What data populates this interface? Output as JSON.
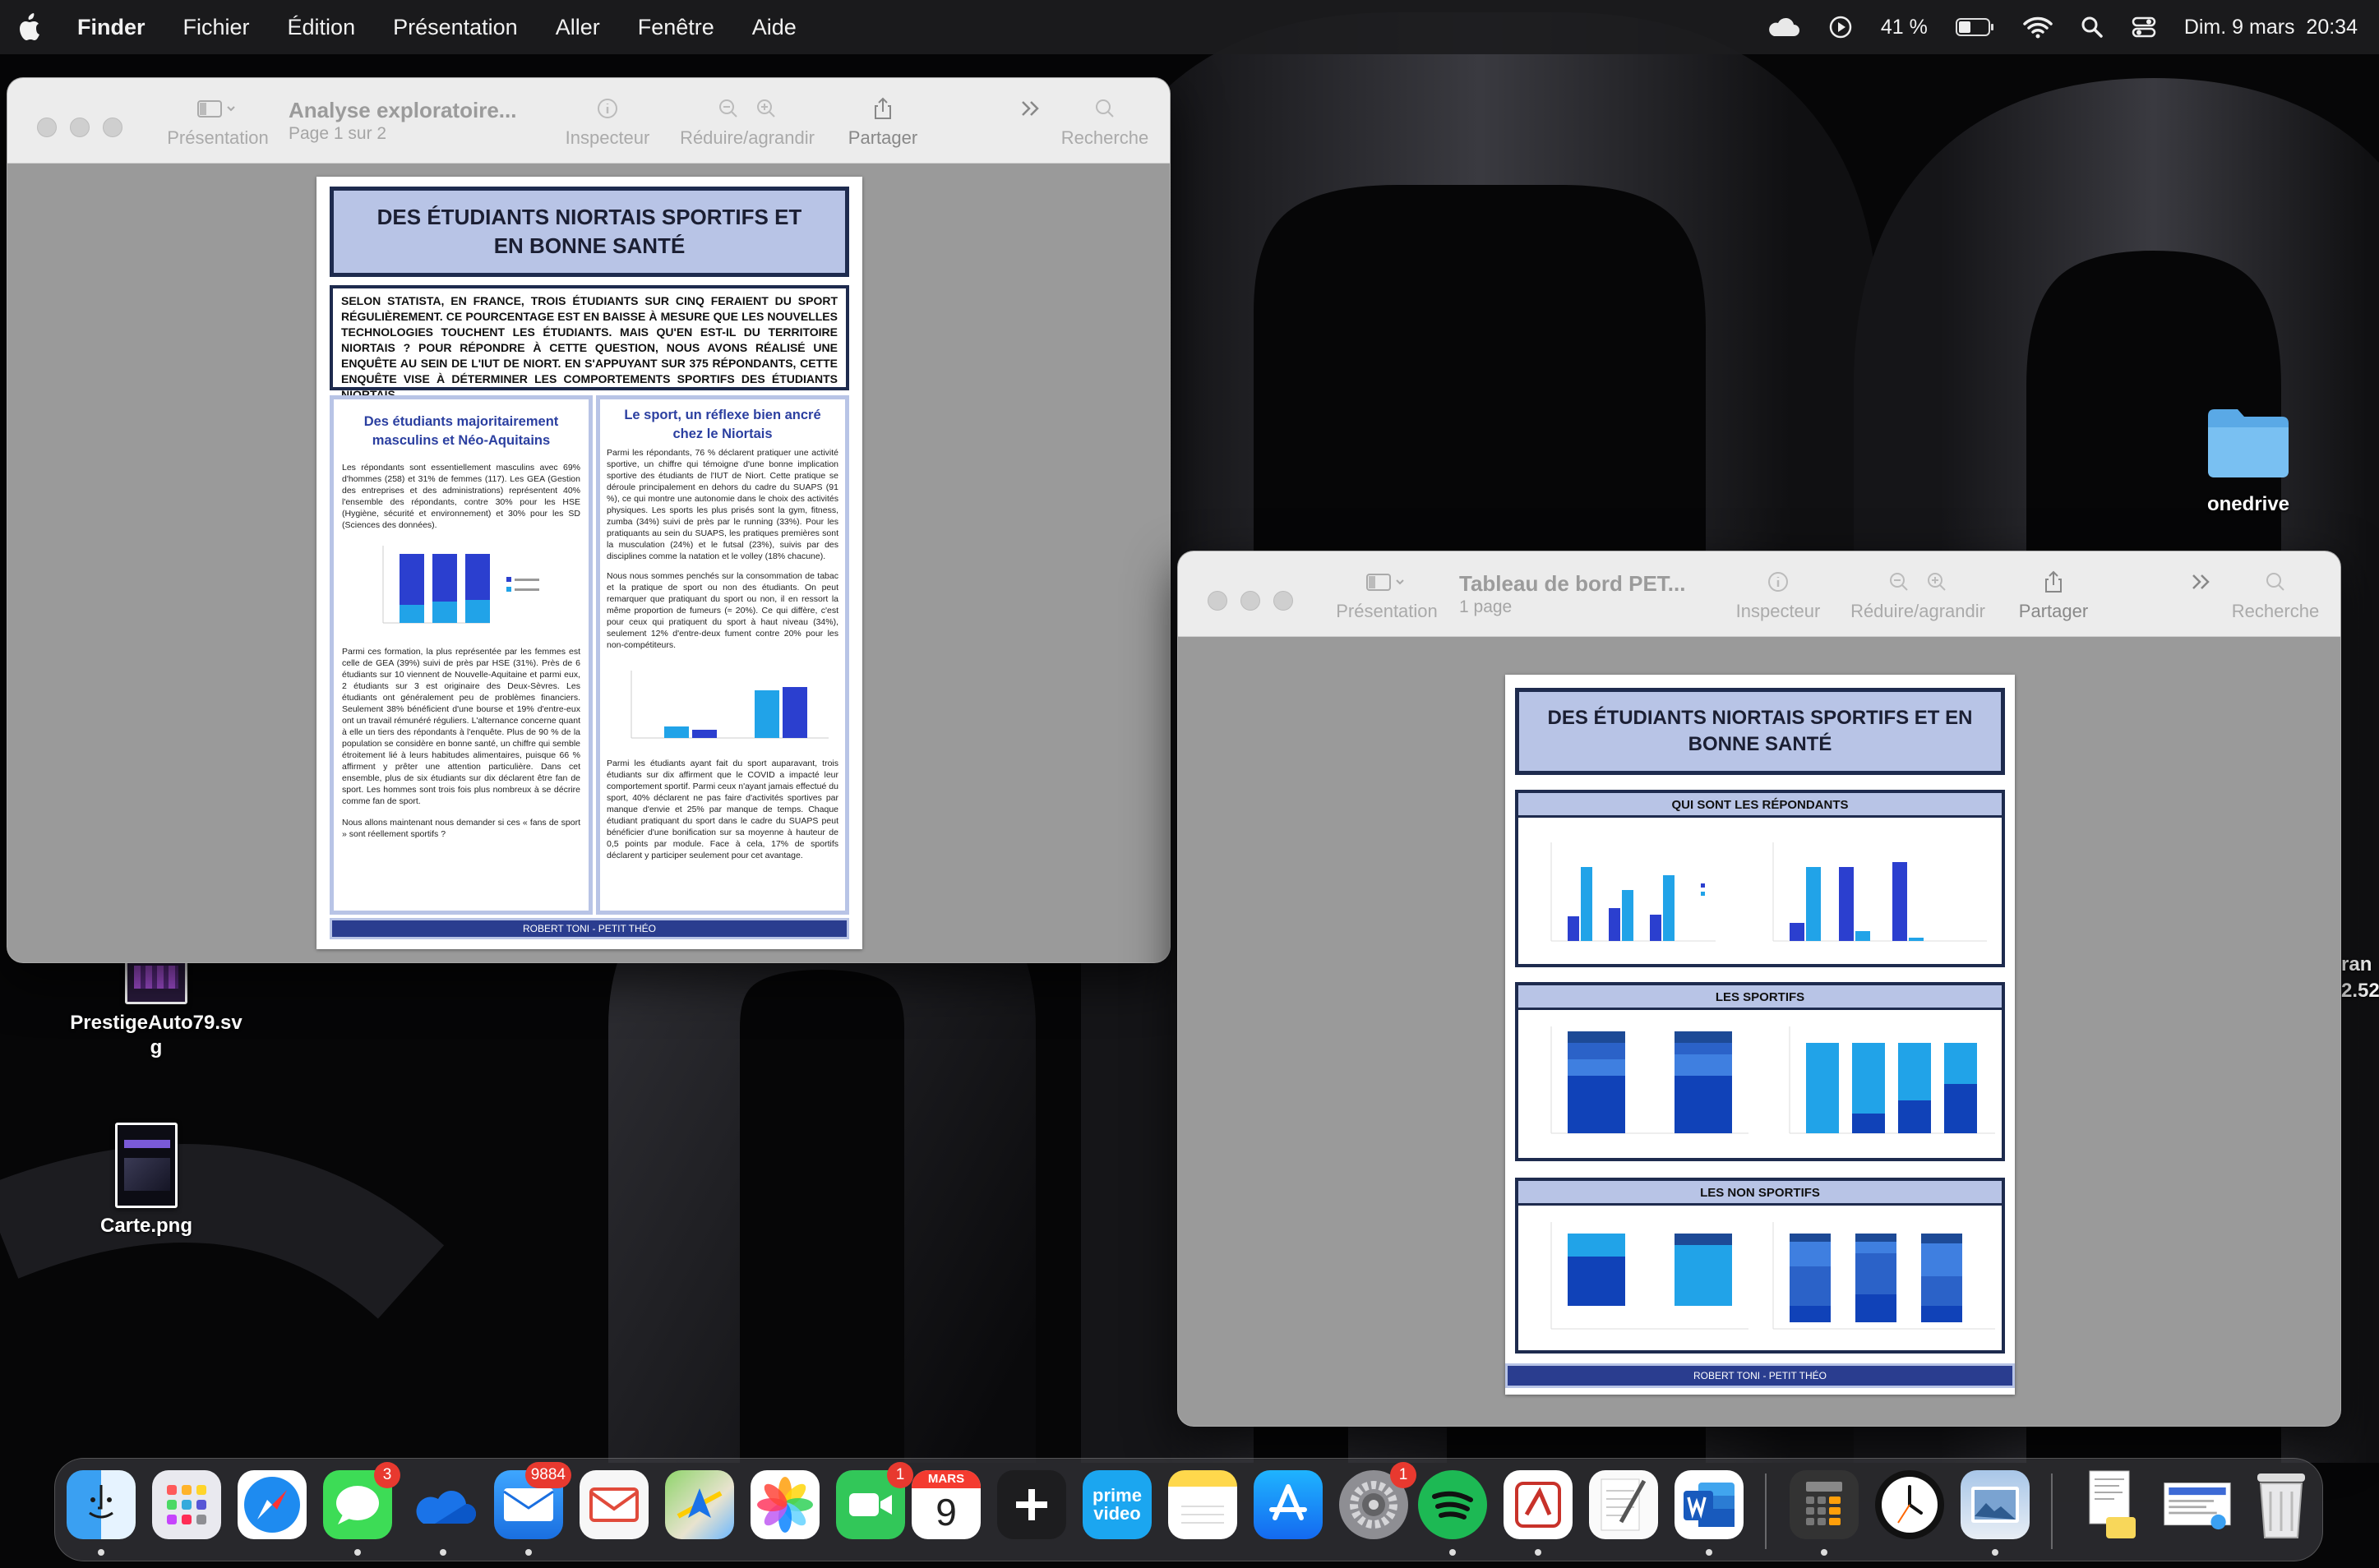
{
  "menubar": {
    "app_name": "Finder",
    "menus": [
      "Fichier",
      "Édition",
      "Présentation",
      "Aller",
      "Fenêtre",
      "Aide"
    ],
    "battery": "41 %",
    "clock": "Dim. 9 mars  20:34"
  },
  "desktop": {
    "icons": [
      {
        "label": "onedrive"
      },
      {
        "label": "PrestigeAuto79.svg"
      },
      {
        "label": "Carte.png"
      }
    ],
    "partial_right_label_1": "ran",
    "partial_right_label_2": "2.52"
  },
  "window1": {
    "title": "Analyse exploratoire...",
    "subtitle": "Page 1 sur 2",
    "toolbar": {
      "presentation": "Présentation",
      "inspector": "Inspecteur",
      "zoom": "Réduire/agrandir",
      "share": "Partager",
      "search": "Recherche"
    },
    "doc": {
      "title": "DES ÉTUDIANTS NIORTAIS SPORTIFS ET EN BONNE SANTÉ",
      "intro": "SELON STATISTA, EN FRANCE, TROIS ÉTUDIANTS SUR CINQ FERAIENT DU SPORT RÉGULIÈREMENT. CE POURCENTAGE EST EN BAISSE À MESURE QUE LES NOUVELLES TECHNOLOGIES TOUCHENT LES ÉTUDIANTS. MAIS QU'EN EST-IL DU TERRITOIRE NIORTAIS ? POUR RÉPONDRE À CETTE QUESTION, NOUS AVONS RÉALISÉ UNE ENQUÊTE AU SEIN DE L'IUT DE NIORT. EN S'APPUYANT SUR 375 RÉPONDANTS, CETTE ENQUÊTE VISE À DÉTERMINER LES COMPORTEMENTS SPORTIFS DES ÉTUDIANTS NIORTAIS.",
      "left_heading": "Des étudiants majoritairement masculins et Néo-Aquitains",
      "left_p1": "Les répondants sont essentiellement masculins avec 69% d'hommes (258) et 31% de femmes (117). Les GEA (Gestion des entreprises et des administrations) représentent 40% l'ensemble des répondants, contre 30% pour les HSE (Hygiène, sécurité et environnement) et 30% pour les SD (Sciences des données).",
      "left_p2": "Parmi ces formation, la plus représentée par les femmes est celle de GEA (39%) suivi de près par HSE (31%). Près de 6 étudiants sur 10 viennent de Nouvelle-Aquitaine et parmi eux, 2 étudiants sur 3 est originaire des Deux-Sèvres. Les étudiants ont généralement peu de problèmes financiers. Seulement 38% bénéficient d'une bourse et 19% d'entre-eux ont un travail rémunéré réguliers. L'alternance concerne quant à elle un tiers des répondants à l'enquête. Plus de 90 % de la population se considère en bonne santé, un chiffre qui semble étroitement lié à leurs habitudes alimentaires, puisque 66 % affirment y prêter une attention particulière. Dans cet ensemble, plus de six étudiants sur dix déclarent être fan de sport. Les hommes sont trois fois plus nombreux à se décrire comme fan de sport.",
      "left_p3": "Nous allons maintenant nous demander si ces « fans de sport » sont réellement sportifs ?",
      "right_heading": "Le sport, un réflexe bien ancré chez le Niortais",
      "right_p1": "Parmi les répondants, 76 % déclarent pratiquer une activité sportive, un chiffre qui témoigne d'une bonne implication sportive des étudiants de l'IUT de Niort. Cette pratique se déroule principalement en dehors du cadre du SUAPS (91 %), ce qui montre une autonomie dans le choix des activités physiques. Les sports les plus prisés sont la gym, fitness, zumba (34%) suivi de près par le running (33%). Pour les pratiquants au sein du SUAPS, les pratiques premières sont la musculation (24%) et le futsal (23%), suivis par des disciplines comme la natation et le volley (18% chacune).",
      "right_p2": "Nous nous sommes penchés sur la consommation de tabac et la pratique de sport ou non des étudiants. On peut remarquer que pratiquant du sport ou non, il en ressort la même proportion de fumeurs (≈ 20%). Ce qui diffère, c'est pour ceux qui pratiquent du sport à haut niveau (34%), seulement 12% d'entre-deux fument contre 20% pour les non-compétiteurs.",
      "right_p3": "Parmi les étudiants ayant fait du sport auparavant, trois étudiants sur dix affirment que le COVID a impacté leur comportement sportif. Parmi ceux n'ayant jamais effectué du sport, 40% déclarent ne pas faire d'activités sportives par manque d'envie et 25% par manque de temps. Chaque étudiant pratiquant du sport dans le cadre du SUAPS peut bénéficier d'une bonification sur sa moyenne à hauteur de 0,5 points par module. Face à cela, 17% de sportifs déclarent y participer seulement pour cet avantage.",
      "footer": "ROBERT TONI  -  PETIT THÉO"
    }
  },
  "window2": {
    "title": "Tableau de bord PET...",
    "subtitle": "1 page",
    "toolbar": {
      "presentation": "Présentation",
      "inspector": "Inspecteur",
      "zoom": "Réduire/agrandir",
      "share": "Partager",
      "search": "Recherche"
    },
    "doc": {
      "title": "DES ÉTUDIANTS NIORTAIS SPORTIFS ET EN BONNE SANTÉ",
      "sections": [
        "QUI SONT LES RÉPONDANTS",
        "LES SPORTIFS",
        "LES NON SPORTIFS"
      ],
      "footer": "ROBERT TONI  -  PETIT THÉO"
    }
  },
  "dock": {
    "apps": [
      {
        "name": "Finder",
        "badge": ""
      },
      {
        "name": "Launchpad",
        "badge": ""
      },
      {
        "name": "Safari",
        "badge": ""
      },
      {
        "name": "Messages",
        "badge": "3"
      },
      {
        "name": "OneDrive",
        "badge": ""
      },
      {
        "name": "Mail",
        "badge": "9884"
      },
      {
        "name": "Airmail",
        "badge": ""
      },
      {
        "name": "Maps",
        "badge": ""
      },
      {
        "name": "Photos",
        "badge": ""
      },
      {
        "name": "FaceTime",
        "badge": "1"
      },
      {
        "name": "Calendar",
        "badge": ""
      },
      {
        "name": "Perplexity",
        "badge": ""
      },
      {
        "name": "Prime Video",
        "badge": ""
      },
      {
        "name": "Notes",
        "badge": ""
      },
      {
        "name": "App Store",
        "badge": ""
      },
      {
        "name": "System Settings",
        "badge": "1"
      },
      {
        "name": "Spotify",
        "badge": ""
      },
      {
        "name": "Keynote",
        "badge": ""
      },
      {
        "name": "TextEdit",
        "badge": ""
      },
      {
        "name": "Word",
        "badge": ""
      },
      {
        "name": "Calculator",
        "badge": ""
      },
      {
        "name": "Clock",
        "badge": ""
      },
      {
        "name": "Preview",
        "badge": ""
      }
    ],
    "calendar_month": "MARS",
    "calendar_day": "9",
    "prime_label_1": "prime",
    "prime_label_2": "video"
  }
}
